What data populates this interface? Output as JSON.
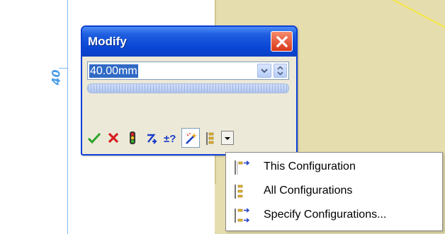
{
  "canvas": {
    "dimension_label": "40"
  },
  "dialog": {
    "title": "Modify",
    "value": "40.00mm",
    "toolbar": [
      {
        "name": "ok-button",
        "icon": "check-icon"
      },
      {
        "name": "cancel-button",
        "icon": "x-icon"
      },
      {
        "name": "rebuild-button",
        "icon": "traffic-light-icon"
      },
      {
        "name": "reverse-sense-button",
        "icon": "reverse-arrow-icon"
      },
      {
        "name": "mark-for-drawing-button",
        "icon": "plus-minus-icon"
      },
      {
        "name": "regenerate-button",
        "icon": "magic-wand-icon"
      },
      {
        "name": "configurations-button",
        "icon": "configurations-icon"
      }
    ]
  },
  "menu": {
    "items": [
      {
        "label": "This Configuration",
        "icon": "this-configuration-icon"
      },
      {
        "label": "All Configurations",
        "icon": "all-configurations-icon"
      },
      {
        "label": "Specify Configurations...",
        "icon": "specify-configurations-icon"
      }
    ]
  },
  "colors": {
    "titlebar": "#0a46d4",
    "selection": "#316ac5",
    "plane": "#e6ddae",
    "dimension": "#4a9de8"
  }
}
